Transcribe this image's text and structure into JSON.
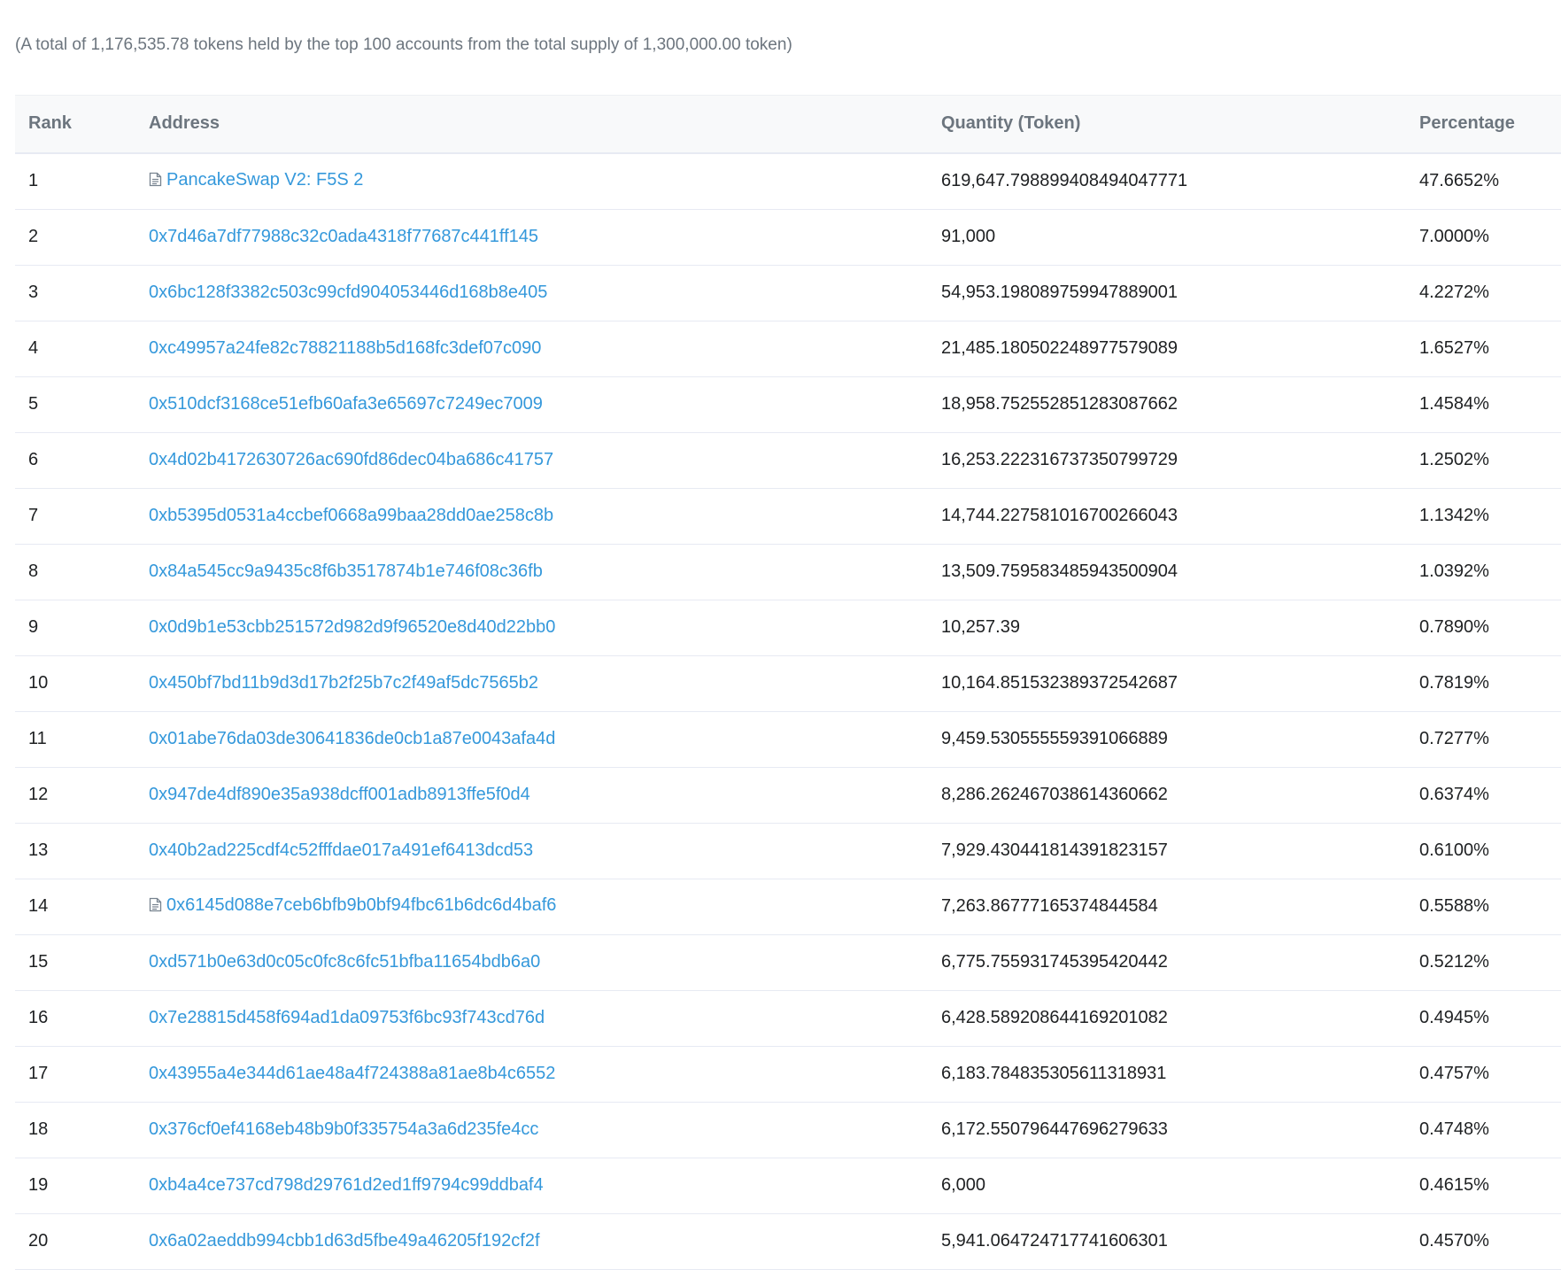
{
  "summary": "(A total of 1,176,535.78 tokens held by the top 100 accounts from the total supply of 1,300,000.00 token)",
  "table": {
    "headers": {
      "rank": "Rank",
      "address": "Address",
      "quantity": "Quantity (Token)",
      "percentage": "Percentage"
    },
    "rows": [
      {
        "rank": "1",
        "address": "PancakeSwap V2: F5S 2",
        "contract": true,
        "quantity": "619,647.798899408494047771",
        "percentage": "47.6652%"
      },
      {
        "rank": "2",
        "address": "0x7d46a7df77988c32c0ada4318f77687c441ff145",
        "contract": false,
        "quantity": "91,000",
        "percentage": "7.0000%"
      },
      {
        "rank": "3",
        "address": "0x6bc128f3382c503c99cfd904053446d168b8e405",
        "contract": false,
        "quantity": "54,953.198089759947889001",
        "percentage": "4.2272%"
      },
      {
        "rank": "4",
        "address": "0xc49957a24fe82c78821188b5d168fc3def07c090",
        "contract": false,
        "quantity": "21,485.180502248977579089",
        "percentage": "1.6527%"
      },
      {
        "rank": "5",
        "address": "0x510dcf3168ce51efb60afa3e65697c7249ec7009",
        "contract": false,
        "quantity": "18,958.752552851283087662",
        "percentage": "1.4584%"
      },
      {
        "rank": "6",
        "address": "0x4d02b4172630726ac690fd86dec04ba686c41757",
        "contract": false,
        "quantity": "16,253.222316737350799729",
        "percentage": "1.2502%"
      },
      {
        "rank": "7",
        "address": "0xb5395d0531a4ccbef0668a99baa28dd0ae258c8b",
        "contract": false,
        "quantity": "14,744.227581016700266043",
        "percentage": "1.1342%"
      },
      {
        "rank": "8",
        "address": "0x84a545cc9a9435c8f6b3517874b1e746f08c36fb",
        "contract": false,
        "quantity": "13,509.759583485943500904",
        "percentage": "1.0392%"
      },
      {
        "rank": "9",
        "address": "0x0d9b1e53cbb251572d982d9f96520e8d40d22bb0",
        "contract": false,
        "quantity": "10,257.39",
        "percentage": "0.7890%"
      },
      {
        "rank": "10",
        "address": "0x450bf7bd11b9d3d17b2f25b7c2f49af5dc7565b2",
        "contract": false,
        "quantity": "10,164.851532389372542687",
        "percentage": "0.7819%"
      },
      {
        "rank": "11",
        "address": "0x01abe76da03de30641836de0cb1a87e0043afa4d",
        "contract": false,
        "quantity": "9,459.530555559391066889",
        "percentage": "0.7277%"
      },
      {
        "rank": "12",
        "address": "0x947de4df890e35a938dcff001adb8913ffe5f0d4",
        "contract": false,
        "quantity": "8,286.262467038614360662",
        "percentage": "0.6374%"
      },
      {
        "rank": "13",
        "address": "0x40b2ad225cdf4c52fffdae017a491ef6413dcd53",
        "contract": false,
        "quantity": "7,929.430441814391823157",
        "percentage": "0.6100%"
      },
      {
        "rank": "14",
        "address": "0x6145d088e7ceb6bfb9b0bf94fbc61b6dc6d4baf6",
        "contract": true,
        "quantity": "7,263.86777165374844584",
        "percentage": "0.5588%"
      },
      {
        "rank": "15",
        "address": "0xd571b0e63d0c05c0fc8c6fc51bfba11654bdb6a0",
        "contract": false,
        "quantity": "6,775.755931745395420442",
        "percentage": "0.5212%"
      },
      {
        "rank": "16",
        "address": "0x7e28815d458f694ad1da09753f6bc93f743cd76d",
        "contract": false,
        "quantity": "6,428.589208644169201082",
        "percentage": "0.4945%"
      },
      {
        "rank": "17",
        "address": "0x43955a4e344d61ae48a4f724388a81ae8b4c6552",
        "contract": false,
        "quantity": "6,183.784835305611318931",
        "percentage": "0.4757%"
      },
      {
        "rank": "18",
        "address": "0x376cf0ef4168eb48b9b0f335754a3a6d235fe4cc",
        "contract": false,
        "quantity": "6,172.550796447696279633",
        "percentage": "0.4748%"
      },
      {
        "rank": "19",
        "address": "0xb4a4ce737cd798d29761d2ed1ff9794c99ddbaf4",
        "contract": false,
        "quantity": "6,000",
        "percentage": "0.4615%"
      },
      {
        "rank": "20",
        "address": "0x6a02aeddb994cbb1d63d5fbe49a46205f192cf2f",
        "contract": false,
        "quantity": "5,941.064724717741606301",
        "percentage": "0.4570%"
      }
    ]
  },
  "icons": {
    "contract": "file-text-icon"
  },
  "colors": {
    "link": "#3498db",
    "muted_text": "#6c757e",
    "header_bg": "#f8f9fa",
    "row_border": "#e7eaf3"
  }
}
